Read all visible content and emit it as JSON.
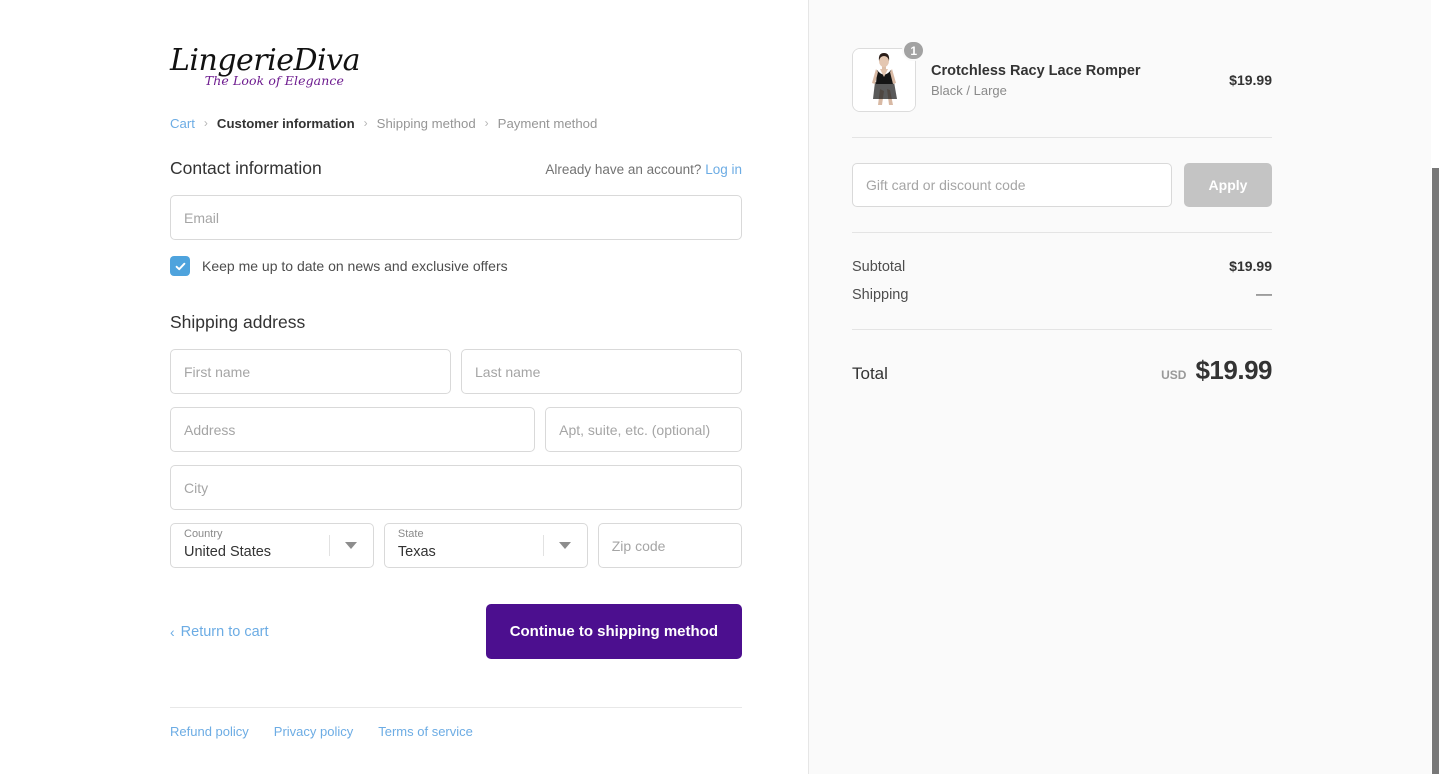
{
  "brand": {
    "logo_text": "LingerieDiva",
    "logo_tagline": "The Look of Elegance",
    "accent_purple": "#6d1b8f",
    "cta_purple": "#4c0f8f",
    "link_blue": "#6cace4"
  },
  "breadcrumb": {
    "items": [
      {
        "label": "Cart",
        "state": "link"
      },
      {
        "label": "Customer information",
        "state": "current"
      },
      {
        "label": "Shipping method",
        "state": "upcoming"
      },
      {
        "label": "Payment method",
        "state": "upcoming"
      }
    ],
    "separator": "›"
  },
  "contact": {
    "title": "Contact information",
    "account_prompt": "Already have an account?",
    "login_label": "Log in",
    "email_placeholder": "Email",
    "email_value": "",
    "newsletter_label": "Keep me up to date on news and exclusive offers",
    "newsletter_checked": true,
    "checkbox_color": "#4ea3dd"
  },
  "shipping_address": {
    "title": "Shipping address",
    "first_name_placeholder": "First name",
    "first_name_value": "",
    "last_name_placeholder": "Last name",
    "last_name_value": "",
    "address_placeholder": "Address",
    "address_value": "",
    "apt_placeholder": "Apt, suite, etc. (optional)",
    "apt_value": "",
    "city_placeholder": "City",
    "city_value": "",
    "country_label": "Country",
    "country_value": "United States",
    "state_label": "State",
    "state_value": "Texas",
    "zip_placeholder": "Zip code",
    "zip_value": ""
  },
  "actions": {
    "return_label": "Return to cart",
    "return_chevron": "‹",
    "continue_label": "Continue to shipping method"
  },
  "footer": {
    "links": [
      {
        "label": "Refund policy"
      },
      {
        "label": "Privacy policy"
      },
      {
        "label": "Terms of service"
      }
    ]
  },
  "order_summary": {
    "line_items": [
      {
        "title": "Crotchless Racy Lace Romper",
        "variant": "Black / Large",
        "quantity": "1",
        "price": "$19.99"
      }
    ],
    "discount_placeholder": "Gift card or discount code",
    "discount_value": "",
    "apply_label": "Apply",
    "totals": [
      {
        "label": "Subtotal",
        "value": "$19.99"
      },
      {
        "label": "Shipping",
        "value": "—"
      }
    ],
    "grand_total": {
      "label": "Total",
      "currency": "USD",
      "amount": "$19.99"
    }
  }
}
